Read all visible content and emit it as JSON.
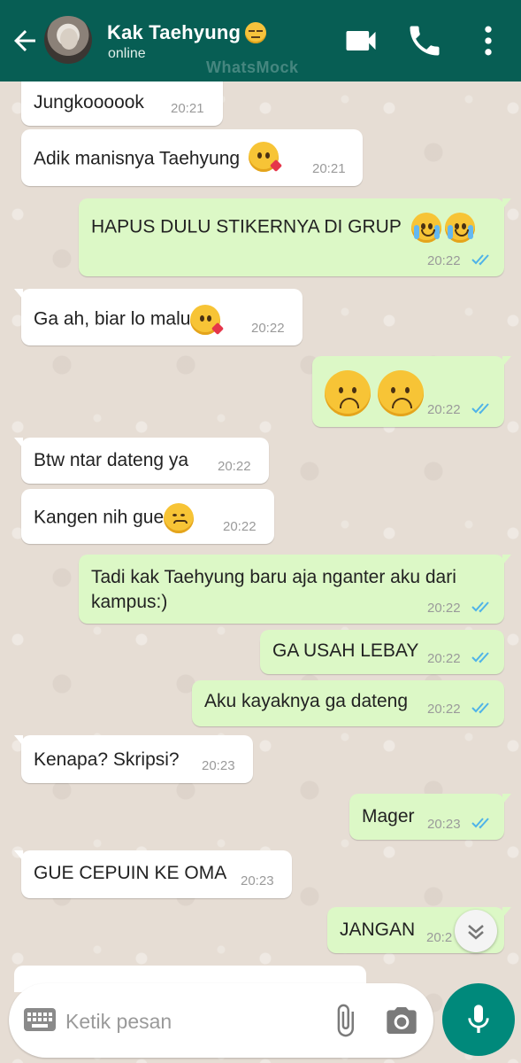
{
  "header": {
    "contact_name": "Kak Taehyung",
    "contact_emoji": "expressionless-face",
    "status": "online",
    "watermark": "WhatsMock",
    "icons": [
      "back-arrow-icon",
      "video-call-icon",
      "phone-icon",
      "more-vert-icon"
    ]
  },
  "messages": [
    {
      "dir": "in",
      "text": "Jungkoooook",
      "time": "20:21"
    },
    {
      "dir": "in",
      "text": "Adik manisnya Taehyung",
      "emoji": "kissing-face",
      "time": "20:21"
    },
    {
      "dir": "out",
      "text": "HAPUS DULU STIKERNYA DI GRUP",
      "emoji": "crying-face x2",
      "time": "20:22",
      "read": true
    },
    {
      "dir": "in",
      "text": "Ga ah, biar lo malu",
      "emoji": "kissing-face",
      "time": "20:22"
    },
    {
      "dir": "out",
      "text": "",
      "emoji": "upside-down-face x2",
      "time": "20:22",
      "read": true
    },
    {
      "dir": "in",
      "text": "Btw ntar dateng ya",
      "time": "20:22"
    },
    {
      "dir": "in",
      "text": "Kangen nih gue",
      "emoji": "pensive-face",
      "time": "20:22"
    },
    {
      "dir": "out",
      "text_line1": "Tadi kak Taehyung baru aja nganter aku dari",
      "text_line2": "kampus:)",
      "time": "20:22",
      "read": true
    },
    {
      "dir": "out",
      "text": "GA USAH LEBAY",
      "time": "20:22",
      "read": true
    },
    {
      "dir": "out",
      "text": "Aku kayaknya ga dateng",
      "time": "20:22",
      "read": true
    },
    {
      "dir": "in",
      "text": "Kenapa? Skripsi?",
      "time": "20:23"
    },
    {
      "dir": "out",
      "text": "Mager",
      "time": "20:23",
      "read": true
    },
    {
      "dir": "in",
      "text": "GUE CEPUIN KE OMA",
      "time": "20:23"
    },
    {
      "dir": "out",
      "text": "JANGAN",
      "time": "20:2",
      "read": true
    }
  ],
  "composer": {
    "placeholder": "Ketik pesan",
    "icons": [
      "keyboard-icon",
      "attach-icon",
      "camera-icon",
      "mic-icon"
    ]
  },
  "colors": {
    "header": "#075e54",
    "outgoing_bubble": "#dcf8c6",
    "incoming_bubble": "#ffffff",
    "read_ticks": "#4fb3e8",
    "mic_button": "#00897b"
  }
}
